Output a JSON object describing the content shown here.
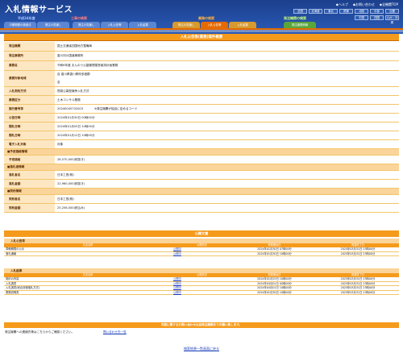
{
  "header": {
    "logo": "入札情報サービス",
    "links": [
      "◆ヘルプ",
      "◆お問い合わせ",
      "◆全機関TOP"
    ],
    "regions_row1": [
      "全国",
      "北海道",
      "東北",
      "関東",
      "北陸",
      "中部",
      "近畿"
    ],
    "regions_row2": [
      "中国",
      "四国",
      "九州・沖縄"
    ]
  },
  "categories": {
    "public": "平成24年度",
    "construction": "工事の検索",
    "service": "業務の検索",
    "local": "発注機関の検索"
  },
  "tabs": {
    "pub1": "中期期間の検索法",
    "pub2": "発注の見通し",
    "con1": "発注の見通し",
    "con2": "入札公告等",
    "con3": "入札結果",
    "srv1": "発注の見通し",
    "srv2": "入札公告等",
    "srv3": "入札結果",
    "lg1": "発注機関情報"
  },
  "title": "入札公告等(業務)案件概要",
  "details": {
    "org_label": "発注機関",
    "org": "国土交通省四国地方整備局",
    "office_label": "発注事務所",
    "office": "香川河川国道事務所",
    "case_label": "業務名",
    "case": "令和6年度 まんのう公園管理運営維持計画業務",
    "area_label": "業務対象地域",
    "area1": "自 香川県香川県仲多度郡",
    "area2": "至",
    "method_label": "入札契約方式",
    "method": "簡易公募型競争入札方式",
    "type_label": "業務区分",
    "type": "土木コンサル業務",
    "num_label": "施行番号等",
    "num": "20240045702003",
    "num_note": "※発注機関が独自に定めるコード",
    "pub_label": "公告日時",
    "pub": "2024年01月30日 00時00分",
    "open_label": "開札日時",
    "open": "2024年01月05日 10時00分",
    "ann_label": "開札日時",
    "ann": "2024年01月12日 10時00分",
    "elec_label": "電子入札対象",
    "elec": "対象",
    "est_sec": "■予定価格情報",
    "est_label": "予定価格",
    "est": "28,570,000(税抜き)",
    "win_sec": "■落札者情報",
    "winner_label": "落札者名",
    "winner": "日本工営(株)",
    "amount_label": "落札金額",
    "amount": "22,960,000(税抜き)",
    "contract_sec": "■契約情報",
    "party_label": "契約者名",
    "party": "日本工営(株)",
    "cost_label": "契約金額",
    "cost": "25,256,000(税込み)"
  },
  "docs": {
    "band": "公開文書",
    "group1": "入札公告等",
    "group2": "入札結果",
    "cols": [
      "文書名称",
      "公開状況",
      "掲載開始日",
      "掲載終了日"
    ],
    "rows1": [
      [
        "準備期限の公示",
        "公開中",
        "2024年01月30日 07時00分",
        "2025年03月31日 23時00分"
      ],
      [
        "落札通報",
        "公開中",
        "2024年01月30日 10時00分",
        "2025年03月31日 23時00分"
      ]
    ],
    "rows2": [
      [
        "契約の内容",
        "公開中",
        "2024年01月25日 10時00分",
        "2025年03月31日 23時00分"
      ],
      [
        "入札調書",
        "公開中",
        "2024年04月01日 00時00分",
        "2025年03月31日 23時00分"
      ],
      [
        "入札調書(総合評価落札方式)",
        "公開中",
        "2024年04月01日 10時00分",
        "2025年03月31日 23時00分"
      ],
      [
        "業務説明書",
        "公開中",
        "2024年01月30日 10時00分",
        "2025年03月31日 23時00分"
      ]
    ]
  },
  "footer": {
    "contact": "内容に関するお問い合わせは各発注機関までお願い致します。",
    "inquiry": "発注機関への連絡先等はこちらからご確認ください。",
    "inquiry_link": "問い合わせ先一覧",
    "back": "検索結果一覧画面に戻る"
  }
}
